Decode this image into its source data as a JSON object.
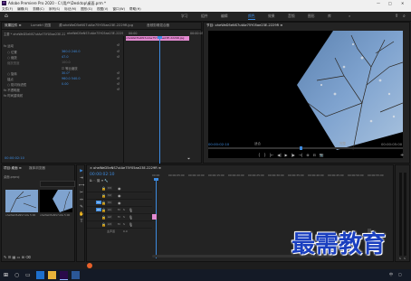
{
  "app": {
    "title": "Adobe Premiere Pro 2020 - C:\\用户\\Desktop\\桌面.prm *",
    "win_controls": [
      "—",
      "□",
      "✕"
    ]
  },
  "menu": [
    "文件(F)",
    "编辑(E)",
    "剪辑(C)",
    "序列(S)",
    "标记(M)",
    "图形(G)",
    "视图(V)",
    "窗口(W)",
    "帮助(H)"
  ],
  "workspaces": {
    "home": "⌂",
    "tabs": [
      "学习",
      "组件",
      "编辑",
      "颜色",
      "效果",
      "音频",
      "图形",
      "库"
    ],
    "active": "编辑",
    "more": "»"
  },
  "effect_controls": {
    "tabs": [
      "效果控件 ≡",
      "Lumetri 范围",
      "源:oheWeD5eNS7utAe75Y05ae23E-2229R.jpg",
      "音频剪辑混合器"
    ],
    "clip_label": "主要 * oheWeD5eNS7utAe75Y05ae23E-2229R.jpg",
    "seq_label": "oheWeD5eNS7utAe75Y05ae23E-2229R.jpg",
    "timecode_start": "00:00",
    "timecode_end": "00:00:05",
    "clip_bar": "oheWeD5eNS7utAe75Y05ae23E-2229R.jpg",
    "sections": [
      {
        "label": "fx 运动",
        "value": ""
      },
      {
        "label": "○ 位置",
        "value": "360.0   240.0"
      },
      {
        "label": "○ 缩放",
        "value": "47.0"
      },
      {
        "label": "  缩放宽度",
        "value": "100.0"
      },
      {
        "label": "",
        "value": "☑ 等比缩放"
      },
      {
        "label": "○ 旋转",
        "value": "30.0°"
      },
      {
        "label": "  锚点",
        "value": "960.0   540.0"
      },
      {
        "label": "○ 防闪烁滤镜",
        "value": "0.00"
      },
      {
        "label": "fx 不透明度",
        "value": ""
      },
      {
        "label": "fx 时间重映射",
        "value": ""
      }
    ],
    "bottom_timecode": "00:00:02:10"
  },
  "program": {
    "tab": "节目: oheWeD5eNS7utAe75Y05ae23E-2229R ≡",
    "timecode": "00:00:02:10",
    "fit": "适合",
    "quality": "完整",
    "duration": "00:00:05:00",
    "controls": [
      "{",
      "}",
      "|←",
      "◀|",
      "▶",
      "|▶",
      "→|",
      "⊕",
      "⊟",
      "📷",
      "+"
    ]
  },
  "project": {
    "tabs": [
      "项目:桌面 ≡",
      "媒体浏览器"
    ],
    "path": "桌面.prproj",
    "search_placeholder": "",
    "items": [
      {
        "name": "oheWeD5eNS7utAe75Y05ae23E-2229R.jpg",
        "duration": "5:00"
      },
      {
        "name": "oheWeD5eNS7utAe75Y05ae23E-2229R",
        "duration": "5:00"
      }
    ]
  },
  "tools": [
    "▶",
    "⇥",
    "⟷",
    "✂",
    "↔",
    "✎",
    "✋",
    "T"
  ],
  "timeline": {
    "tab": "× oheWeD5eNS7utAe75Y05ae23E-2229R ≡",
    "timecode": "00:00:02:10",
    "ruler": [
      "00:00",
      "00:00:05:00",
      "00:00:10:00",
      "00:00:15:00",
      "00:00:20:00",
      "00:00:25:00",
      "00:00:30:00",
      "00:00:35:00",
      "00:00:40:00",
      "00:00:45:00",
      "00:00:50:00",
      "00:00:55:00",
      "00:01:00:00"
    ],
    "tracks": [
      "V3",
      "V2",
      "V1",
      "A1",
      "A2",
      "A3"
    ],
    "master": "主声道",
    "master_value": "0.0"
  },
  "watermark": "最需教育",
  "taskbar": {
    "time": "",
    "lang": "中"
  },
  "colors": {
    "accent_blue": "#3d8be0",
    "clip_pink": "#e28ad0",
    "panel_bg": "#232323",
    "dark_bg": "#1d1d1d"
  }
}
